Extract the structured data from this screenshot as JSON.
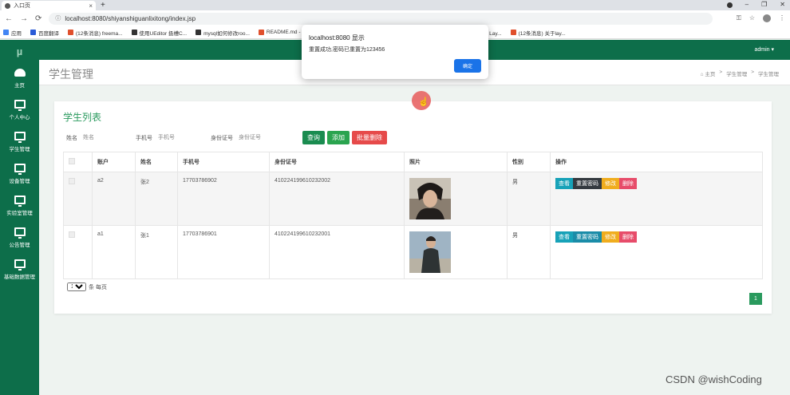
{
  "browser": {
    "tab_title": "入口页",
    "url": "localhost:8080/shiyanshiguanlixitong/index.jsp",
    "bookmarks": [
      {
        "label": "应用",
        "color": "#4285f4"
      },
      {
        "label": "百度翻译",
        "color": "#2a5bd7"
      },
      {
        "label": "(12条消息) freema...",
        "color": "#e0502d"
      },
      {
        "label": "使用UEditor 扱槽C...",
        "color": "#333333"
      },
      {
        "label": "mysql如何修改roo...",
        "color": "#333333"
      },
      {
        "label": "README.md - T...",
        "color": "#e0502d"
      },
      {
        "label": "如何用正则匹配: 2...",
        "color": "#3366cc"
      },
      {
        "label": "layDate - JS日期与...",
        "color": "#222222"
      },
      {
        "label": "表单模块文档 - Lay...",
        "color": "#222222"
      },
      {
        "label": "(12条消息) 关于lay...",
        "color": "#e0502d"
      }
    ]
  },
  "app": {
    "logo": "µ",
    "user": "admin ▾",
    "sidebar": [
      {
        "label": "主页",
        "icon": "home-icon"
      },
      {
        "label": "个人中心",
        "icon": "monitor-icon"
      },
      {
        "label": "学生管理",
        "icon": "monitor-icon"
      },
      {
        "label": "设备管理",
        "icon": "monitor-icon"
      },
      {
        "label": "实验室管理",
        "icon": "monitor-icon"
      },
      {
        "label": "公告管理",
        "icon": "monitor-icon"
      },
      {
        "label": "基础数据管理",
        "icon": "monitor-icon"
      }
    ],
    "page_title": "学生管理",
    "breadcrumb": [
      "⌂ 主页",
      ">",
      "学生管理",
      ">",
      "学生管理"
    ]
  },
  "list": {
    "title": "学生列表",
    "filters": [
      {
        "label": "姓名",
        "placeholder": "姓名"
      },
      {
        "label": "手机号",
        "placeholder": "手机号"
      },
      {
        "label": "身份证号",
        "placeholder": "身份证号"
      }
    ],
    "buttons": {
      "query": "查询",
      "add": "添加",
      "batch_delete": "批量删除"
    },
    "columns": [
      "",
      "账户",
      "姓名",
      "手机号",
      "身份证号",
      "照片",
      "性别",
      "操作"
    ],
    "rows": [
      {
        "account": "a2",
        "name": "张2",
        "phone": "17703786902",
        "id_number": "410224199610232002",
        "gender": "男"
      },
      {
        "account": "a1",
        "name": "张1",
        "phone": "17703786901",
        "id_number": "410224199610232001",
        "gender": "男"
      }
    ],
    "row_actions": [
      {
        "view": "查看",
        "reset": "重置密码",
        "edit": "修改",
        "delete": "删除"
      },
      {
        "view": "查看",
        "reset": "重置密码",
        "edit": "修改",
        "delete": "删除"
      }
    ],
    "page_size": "10",
    "page_size_suffix": "条 每页",
    "current_page": "1"
  },
  "dialog": {
    "title": "localhost:8080 显示",
    "message": "重置成功,密码已重置为123456",
    "ok": "确定"
  },
  "watermark": "CSDN @wishCoding"
}
